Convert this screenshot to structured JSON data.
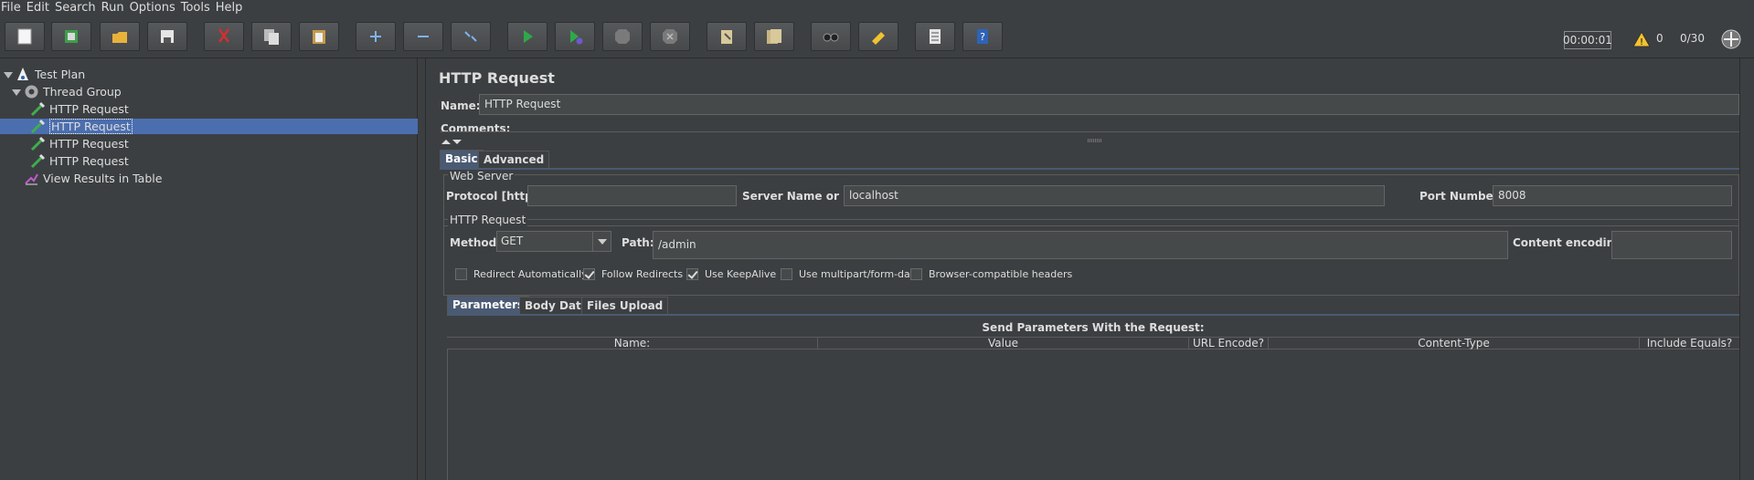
{
  "menu": [
    "File",
    "Edit",
    "Search",
    "Run",
    "Options",
    "Tools",
    "Help"
  ],
  "toolbar": {
    "buttons": [
      {
        "name": "new-icon"
      },
      {
        "name": "templates-icon"
      },
      {
        "name": "open-icon"
      },
      {
        "name": "save-icon"
      },
      {
        "name": "cut-icon"
      },
      {
        "name": "copy-icon"
      },
      {
        "name": "paste-icon"
      },
      {
        "name": "expand-icon"
      },
      {
        "name": "collapse-icon"
      },
      {
        "name": "toggle-icon"
      },
      {
        "name": "start-icon"
      },
      {
        "name": "start-no-pauses-icon"
      },
      {
        "name": "stop-icon"
      },
      {
        "name": "shutdown-icon"
      },
      {
        "name": "clear-icon"
      },
      {
        "name": "clear-all-icon"
      },
      {
        "name": "search-icon"
      },
      {
        "name": "reset-search-icon"
      },
      {
        "name": "function-helper-icon"
      },
      {
        "name": "help-icon"
      }
    ],
    "timer": "00:00:01",
    "warnings": "0",
    "threads": "0/30"
  },
  "tree": {
    "items": [
      {
        "label": "Test Plan"
      },
      {
        "label": "Thread Group"
      },
      {
        "label": "HTTP Request"
      },
      {
        "label": "HTTP Request"
      },
      {
        "label": "HTTP Request"
      },
      {
        "label": "HTTP Request"
      },
      {
        "label": "View Results in Table"
      }
    ]
  },
  "form": {
    "title": "HTTP Request",
    "name_label": "Name:",
    "name_value": "HTTP Request",
    "comments_label": "Comments:",
    "tabs": [
      "Basic",
      "Advanced"
    ],
    "web_server": {
      "title": "Web Server",
      "protocol_label": "Protocol [http]:",
      "protocol_value": "",
      "server_label": "Server Name or IP:",
      "server_value": "localhost",
      "port_label": "Port Number:",
      "port_value": "8008"
    },
    "http_request": {
      "title": "HTTP Request",
      "method_label": "Method:",
      "method_value": "GET",
      "path_label": "Path:",
      "path_value": "/admin",
      "encoding_label": "Content encoding:",
      "encoding_value": ""
    },
    "checkboxes": [
      {
        "label": "Redirect Automatically",
        "checked": false
      },
      {
        "label": "Follow Redirects",
        "checked": true
      },
      {
        "label": "Use KeepAlive",
        "checked": true
      },
      {
        "label": "Use multipart/form-data",
        "checked": false
      },
      {
        "label": "Browser-compatible headers",
        "checked": false
      }
    ],
    "sub_tabs": [
      "Parameters",
      "Body Data",
      "Files Upload"
    ],
    "params_title": "Send Parameters With the Request:",
    "columns": [
      "Name:",
      "Value",
      "URL Encode?",
      "Content-Type",
      "Include Equals?"
    ]
  }
}
